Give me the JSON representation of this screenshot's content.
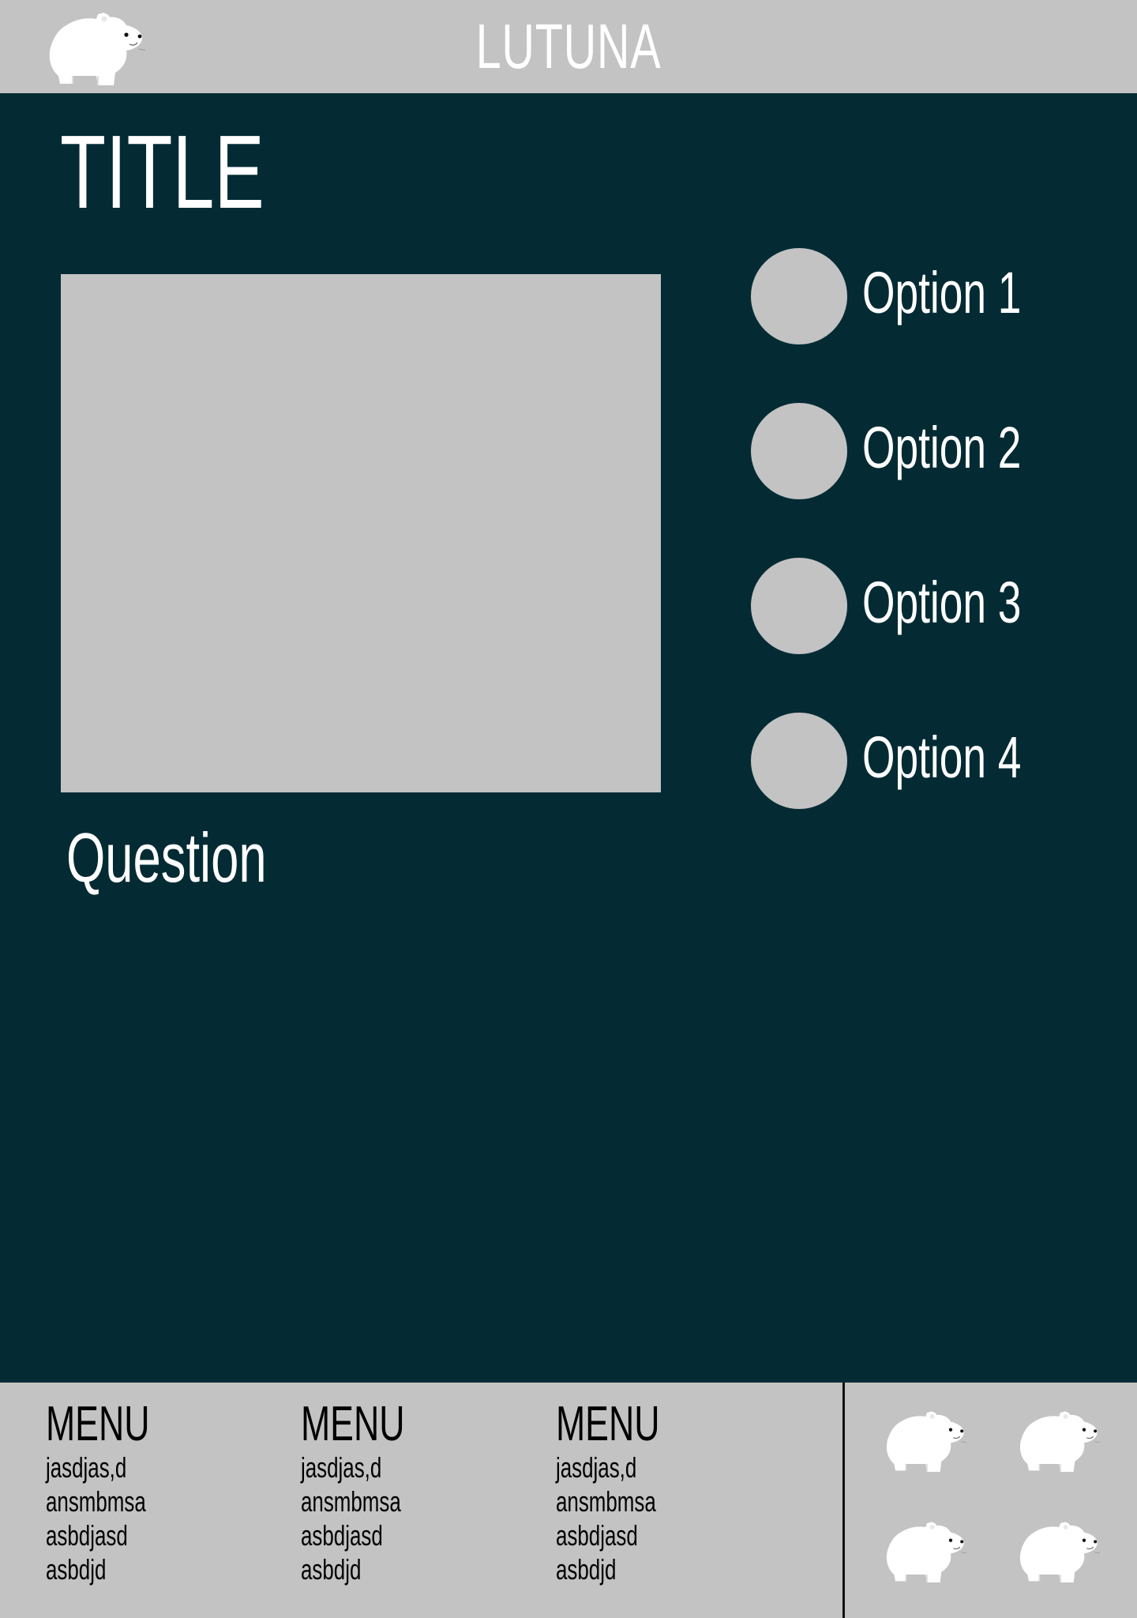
{
  "header": {
    "brand": "LUTUNA",
    "logo_icon": "polar-bear-icon"
  },
  "main": {
    "title": "TITLE",
    "question": "Question",
    "options": [
      {
        "label": "Option 1"
      },
      {
        "label": "Option 2"
      },
      {
        "label": "Option 3"
      },
      {
        "label": "Option 4"
      }
    ]
  },
  "footer": {
    "menus": [
      {
        "heading": "MENU",
        "items": [
          "jasdjas,d",
          "ansmbmsa",
          "asbdjasd",
          "asbdjd"
        ]
      },
      {
        "heading": "MENU",
        "items": [
          "jasdjas,d",
          "ansmbmsa",
          "asbdjasd",
          "asbdjd"
        ]
      },
      {
        "heading": "MENU",
        "items": [
          "jasdjas,d",
          "ansmbmsa",
          "asbdjasd",
          "asbdjd"
        ]
      }
    ],
    "social_icons": [
      "polar-bear-icon",
      "polar-bear-icon",
      "polar-bear-icon",
      "polar-bear-icon"
    ]
  },
  "colors": {
    "background": "#042b34",
    "panel": "#c3c3c3",
    "text_light": "#ffffff",
    "text_dark": "#000000"
  }
}
